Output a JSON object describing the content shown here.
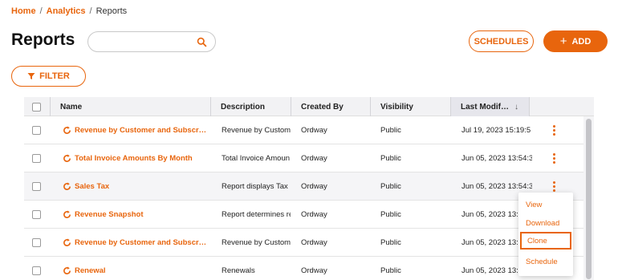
{
  "breadcrumb": {
    "home": "Home",
    "sep1": "/",
    "analytics": "Analytics",
    "sep2": "/",
    "current": "Reports"
  },
  "page": {
    "title": "Reports"
  },
  "search": {
    "placeholder": "",
    "value": "",
    "icon": "search-icon"
  },
  "toolbar": {
    "schedules_label": "SCHEDULES",
    "add_label": "ADD",
    "add_icon": "+",
    "filter_label": "FILTER",
    "filter_icon": "funnel-icon"
  },
  "colors": {
    "accent": "#e8650d",
    "header_bg": "#f2f2f4",
    "row_hover": "#f5f5f7"
  },
  "table": {
    "columns": [
      {
        "label": ""
      },
      {
        "label": "Name"
      },
      {
        "label": "Description"
      },
      {
        "label": "Created By"
      },
      {
        "label": "Visibility"
      },
      {
        "label": "Last Modif…",
        "sort": "descending",
        "sort_icon": "↓"
      }
    ],
    "rows": [
      {
        "name": "Revenue by Customer and Subscr…",
        "description": "Revenue by Custom",
        "created_by": "Ordway",
        "visibility": "Public",
        "last_modified": "Jul 19, 2023 15:19:5"
      },
      {
        "name": "Total Invoice Amounts By Month",
        "description": "Total Invoice Amoun",
        "created_by": "Ordway",
        "visibility": "Public",
        "last_modified": "Jun 05, 2023 13:54:3"
      },
      {
        "name": "Sales Tax",
        "description": "Report displays Tax",
        "created_by": "Ordway",
        "visibility": "Public",
        "last_modified": "Jun 05, 2023 13:54:3"
      },
      {
        "name": "Revenue Snapshot",
        "description": "Report determines re",
        "created_by": "Ordway",
        "visibility": "Public",
        "last_modified": "Jun 05, 2023 13:5"
      },
      {
        "name": "Revenue by Customer and Subscr…",
        "description": "Revenue by Custom",
        "created_by": "Ordway",
        "visibility": "Public",
        "last_modified": "Jun 05, 2023 13:5"
      },
      {
        "name": "Renewal",
        "description": "Renewals",
        "created_by": "Ordway",
        "visibility": "Public",
        "last_modified": "Jun 05, 2023 13:5"
      }
    ]
  },
  "context_menu": {
    "items": [
      {
        "label": "View"
      },
      {
        "label": "Download"
      },
      {
        "label": "Clone",
        "focused": true
      },
      {
        "label": "Schedule"
      }
    ]
  }
}
